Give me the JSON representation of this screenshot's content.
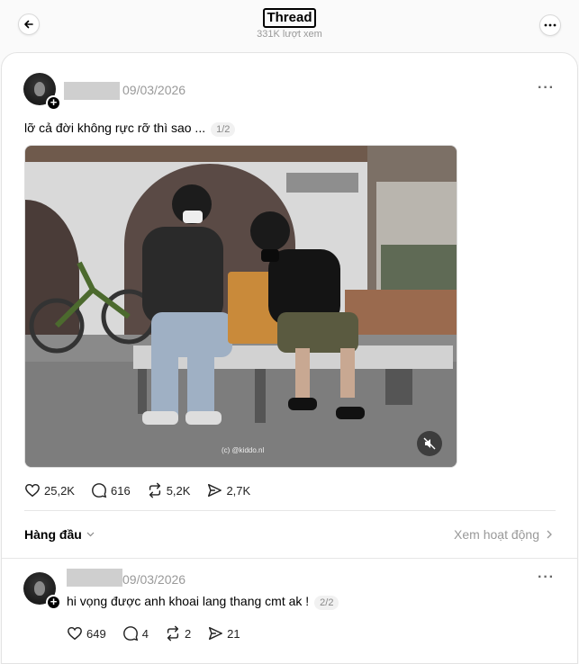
{
  "header": {
    "title": "Thread",
    "views": "331K lượt xem",
    "back_icon": "arrow-left-icon",
    "more_icon": "more-horizontal-icon"
  },
  "post": {
    "date": "09/03/2026",
    "text": "lỡ cả đời không rực rỡ thì sao ...",
    "page": "1/2",
    "media_credit": "(c) @kiddo.nl",
    "stats": {
      "likes": "25,2K",
      "comments": "616",
      "reposts": "5,2K",
      "shares": "2,7K"
    }
  },
  "sort_bar": {
    "sort_label": "Hàng đầu",
    "activity_label": "Xem hoạt động"
  },
  "reply": {
    "date": "09/03/2026",
    "text": "hi vọng được anh khoai lang thang cmt ak !",
    "page": "2/2",
    "stats": {
      "likes": "649",
      "comments": "4",
      "reposts": "2",
      "shares": "21"
    }
  }
}
